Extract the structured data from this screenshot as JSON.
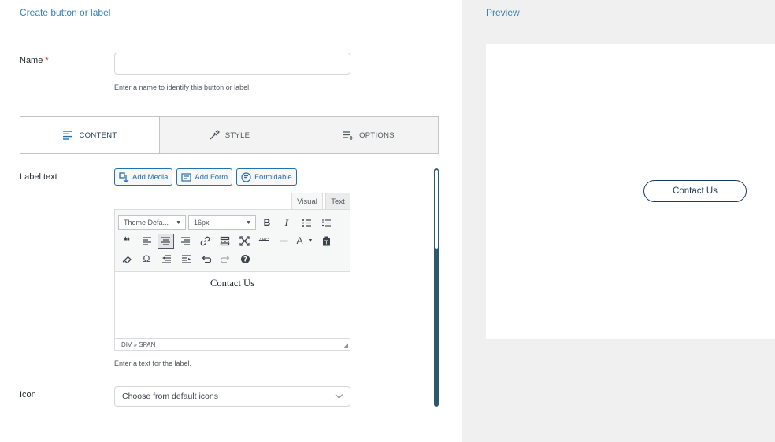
{
  "left": {
    "title": "Create button or label",
    "name_field": {
      "label": "Name",
      "required_mark": "*",
      "value": "",
      "placeholder": "",
      "help": "Enter a name to identify this button or label."
    },
    "tabs": [
      {
        "label": "CONTENT",
        "icon": "align-left-icon",
        "active": true
      },
      {
        "label": "STYLE",
        "icon": "eyedropper-icon",
        "active": false
      },
      {
        "label": "OPTIONS",
        "icon": "list-add-icon",
        "active": false
      }
    ],
    "label_text": {
      "label": "Label text",
      "media_buttons": [
        {
          "label": "Add Media",
          "icon": "media-icon"
        },
        {
          "label": "Add Form",
          "icon": "form-icon"
        },
        {
          "label": "Formidable",
          "icon": "formidable-icon"
        }
      ],
      "editor_tabs": {
        "visual": "Visual",
        "text": "Text"
      },
      "font_family": "Theme Defa...",
      "font_size": "16px",
      "content": "Contact Us",
      "path": "DIV » SPAN",
      "help": "Enter a text for the label."
    },
    "icon_field": {
      "label": "Icon",
      "selected": "Choose from default icons"
    }
  },
  "preview": {
    "title": "Preview",
    "button_label": "Contact Us"
  },
  "colors": {
    "accent": "#3582b8",
    "link": "#2271b1",
    "navy": "#1d3b5a",
    "scrollbar": "#2d5a68",
    "panel_bg": "#f0f0f0"
  }
}
